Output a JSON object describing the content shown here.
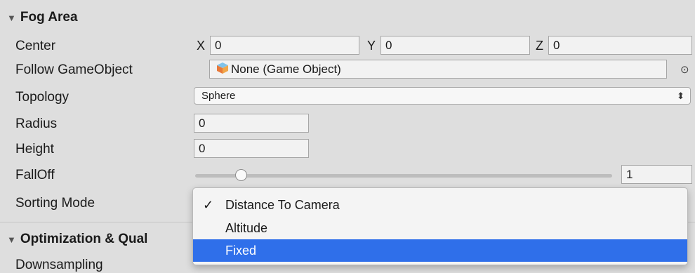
{
  "sections": {
    "fog_area": "Fog Area",
    "optimization": "Optimization & Qual"
  },
  "rows": {
    "center": "Center",
    "follow": "Follow GameObject",
    "topology": "Topology",
    "radius": "Radius",
    "height": "Height",
    "falloff": "FallOff",
    "sorting": "Sorting Mode",
    "downsampling": "Downsampling"
  },
  "center": {
    "x_label": "X",
    "x_value": "0",
    "y_label": "Y",
    "y_value": "0",
    "z_label": "Z",
    "z_value": "0"
  },
  "follow_value": "None (Game Object)",
  "topology_value": "Sphere",
  "radius_value": "0",
  "height_value": "0",
  "falloff": {
    "value": "1",
    "slider_fraction": 0.11
  },
  "sorting_menu": {
    "items": [
      "Distance To Camera",
      "Altitude",
      "Fixed"
    ],
    "checked_index": 0,
    "highlighted_index": 2
  },
  "colors": {
    "highlight": "#2f6fea",
    "background": "#dedede"
  },
  "icons": {
    "triangle": "disclosure-triangle-icon",
    "object": "gameobject-cube-icon",
    "picker": "object-picker-icon",
    "updown": "updown-arrows-icon",
    "check": "checkmark-icon"
  }
}
